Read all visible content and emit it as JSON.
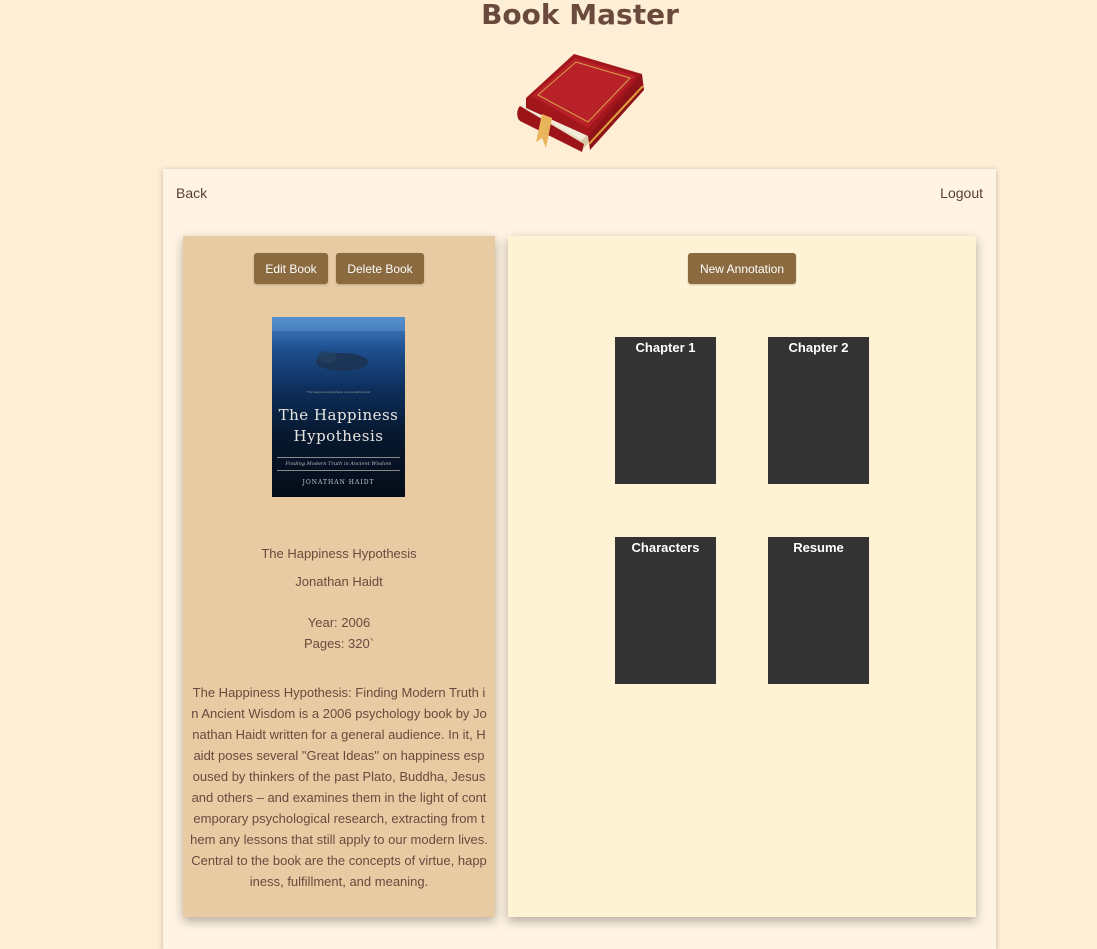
{
  "app": {
    "title": "Book Master"
  },
  "nav": {
    "back_label": "Back",
    "logout_label": "Logout"
  },
  "book_actions": {
    "edit_label": "Edit Book",
    "delete_label": "Delete Book"
  },
  "book": {
    "cover": {
      "blurb": "\"The Happiness Hypothesis is a wonderful book\"",
      "title_line1": "The Happiness",
      "title_line2": "Hypothesis",
      "subtitle": "Finding Modern Truth in Ancient Wisdom",
      "author": "JONATHAN HAIDT"
    },
    "title": "The Happiness Hypothesis",
    "author": "Jonathan Haidt",
    "year_text": "Year: 2006",
    "pages_text": "Pages: 320`",
    "description": "The Happiness Hypothesis: Finding Modern Truth in Ancient Wisdom is a 2006 psychology book by Jonathan Haidt written for a general audience. In it, Haidt poses several \"Great Ideas\" on happiness espoused by thinkers of the past Plato, Buddha, Jesus and others – and examines them in the light of contemporary psychological research, extracting from them any lessons that still apply to our modern lives. Central to the book are the concepts of virtue, happiness, fulfillment, and meaning."
  },
  "annotations": {
    "new_label": "New Annotation",
    "items": [
      {
        "label": "Chapter 1"
      },
      {
        "label": "Chapter 2"
      },
      {
        "label": "Characters"
      },
      {
        "label": "Resume"
      }
    ]
  },
  "colors": {
    "page_bg": "#ffeed6",
    "button": "#8b6a3f",
    "left_panel": "#e8cba3",
    "right_panel": "#fff3d6",
    "tile": "#333333"
  }
}
